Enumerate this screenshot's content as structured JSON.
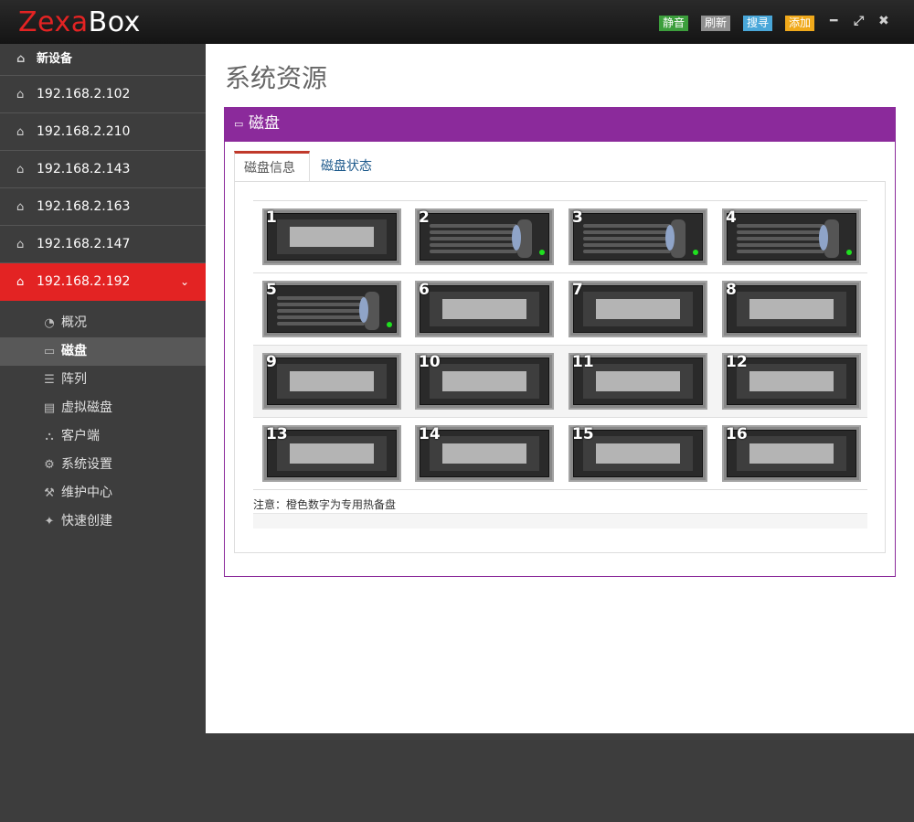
{
  "header": {
    "logo_part1": "Zexa",
    "logo_part2": "Box",
    "buttons": {
      "mute": "静音",
      "refresh": "刷新",
      "search": "搜寻",
      "add": "添加"
    },
    "window_controls": {
      "minimize": "━",
      "maximize": "⤢",
      "close": "✖"
    },
    "colors": {
      "mute": "#3c9e3c",
      "refresh": "#8f8f8f",
      "search": "#49a7d9",
      "add": "#f0a91b"
    }
  },
  "sidebar": {
    "devices": [
      {
        "label": "新设备",
        "icon": "home-icon"
      },
      {
        "label": "192.168.2.102",
        "icon": "home-icon"
      },
      {
        "label": "192.168.2.210",
        "icon": "home-icon"
      },
      {
        "label": "192.168.2.143",
        "icon": "home-icon"
      },
      {
        "label": "192.168.2.163",
        "icon": "home-icon"
      },
      {
        "label": "192.168.2.147",
        "icon": "home-icon"
      },
      {
        "label": "192.168.2.192",
        "icon": "home-icon",
        "active": true
      }
    ],
    "submenu": [
      {
        "label": "概况",
        "icon": "dashboard-icon"
      },
      {
        "label": "磁盘",
        "icon": "hdd-icon",
        "active": true
      },
      {
        "label": "阵列",
        "icon": "server-icon"
      },
      {
        "label": "虚拟磁盘",
        "icon": "list-icon"
      },
      {
        "label": "客户端",
        "icon": "sitemap-icon"
      },
      {
        "label": "系统设置",
        "icon": "cogs-icon"
      },
      {
        "label": "维护中心",
        "icon": "wrench-icon"
      },
      {
        "label": "快速创建",
        "icon": "magic-icon"
      }
    ],
    "accent_color": "#e32323"
  },
  "main": {
    "page_title": "系统资源",
    "panel": {
      "title": "磁盘",
      "color": "#8b2a9b",
      "tabs": [
        {
          "label": "磁盘信息",
          "active": true
        },
        {
          "label": "磁盘状态"
        }
      ],
      "bays": [
        {
          "number": "1",
          "disk": false
        },
        {
          "number": "2",
          "disk": true
        },
        {
          "number": "3",
          "disk": true
        },
        {
          "number": "4",
          "disk": true
        },
        {
          "number": "5",
          "disk": true
        },
        {
          "number": "6",
          "disk": false
        },
        {
          "number": "7",
          "disk": false
        },
        {
          "number": "8",
          "disk": false
        },
        {
          "number": "9",
          "disk": false
        },
        {
          "number": "10",
          "disk": false
        },
        {
          "number": "11",
          "disk": false
        },
        {
          "number": "12",
          "disk": false
        },
        {
          "number": "13",
          "disk": false
        },
        {
          "number": "14",
          "disk": false
        },
        {
          "number": "15",
          "disk": false
        },
        {
          "number": "16",
          "disk": false
        }
      ],
      "note": "注意：橙色数字为专用热备盘"
    }
  }
}
